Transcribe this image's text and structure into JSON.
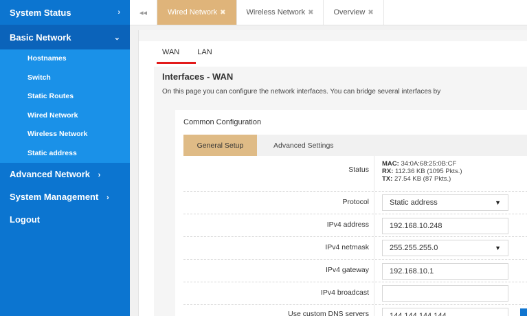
{
  "sidebar": {
    "system_status": "System Status",
    "basic_network": "Basic Network",
    "basic_items": [
      "Hostnames",
      "Switch",
      "Static Routes",
      "Wired Network",
      "Wireless Network",
      "Static address"
    ],
    "advanced_network": "Advanced Network",
    "system_management": "System Management",
    "logout": "Logout",
    "chevron_right": "›",
    "chevron_down": "⌄"
  },
  "tabs": {
    "back": "◂◂",
    "items": [
      {
        "label": "Wired Network",
        "active": true
      },
      {
        "label": "Wireless Network",
        "active": false
      },
      {
        "label": "Overview",
        "active": false
      }
    ],
    "close": "✖"
  },
  "subtabs": [
    "WAN",
    "LAN"
  ],
  "page": {
    "title": "Interfaces - WAN",
    "description": "On this page you can configure the network interfaces. You can bridge several interfaces by"
  },
  "section": {
    "title": "Common Configuration",
    "tabs": [
      "General Setup",
      "Advanced Settings"
    ]
  },
  "status": {
    "label": "Status",
    "mac_key": "MAC:",
    "mac": "34:0A:68:25:0B:CF",
    "rx_key": "RX:",
    "rx": "112.36 KB (1095 Pkts.)",
    "tx_key": "TX:",
    "tx": "27.54 KB (87 Pkts.)"
  },
  "fields": {
    "protocol_label": "Protocol",
    "protocol_value": "Static address",
    "ipv4_address_label": "IPv4 address",
    "ipv4_address_value": "192.168.10.248",
    "ipv4_netmask_label": "IPv4 netmask",
    "ipv4_netmask_value": "255.255.255.0",
    "ipv4_gateway_label": "IPv4 gateway",
    "ipv4_gateway_value": "192.168.10.1",
    "ipv4_broadcast_label": "IPv4 broadcast",
    "ipv4_broadcast_value": "",
    "dns_label": "Use custom DNS servers",
    "dns_value": "144.144.144.144",
    "add": "+",
    "caret": "▼"
  },
  "colors": {
    "sidebar_bg": "#0c75d0",
    "submenu_bg": "#1a91e8",
    "active_tab": "#dfb47a",
    "accent_red": "#e21a1a",
    "button_blue": "#1175cf"
  }
}
